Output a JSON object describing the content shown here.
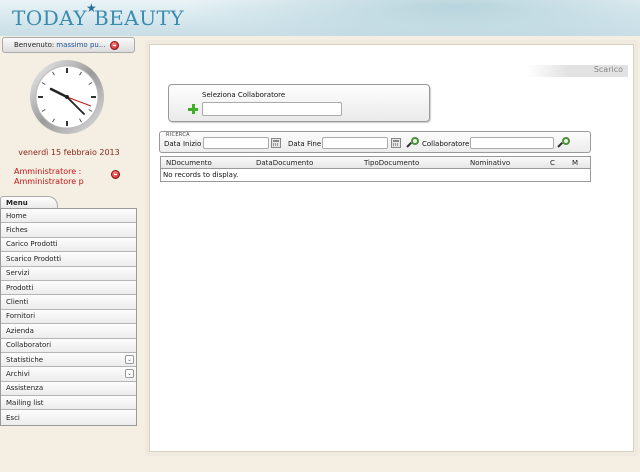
{
  "header": {
    "logo": "TODAY BEAUTY",
    "star": "★"
  },
  "welcome": {
    "label": "Benvenuto:",
    "user": "massimo pu..."
  },
  "date": "venerdì 15 febbraio 2013",
  "admin": {
    "line1": "Amministratore :",
    "line2": "Amministratore p"
  },
  "menu": {
    "tab": "Menu",
    "items": [
      {
        "label": "Home"
      },
      {
        "label": "Fiches"
      },
      {
        "label": "Carico Prodotti"
      },
      {
        "label": "Scarico Prodotti"
      },
      {
        "label": "Servizi"
      },
      {
        "label": "Prodotti"
      },
      {
        "label": "Clienti"
      },
      {
        "label": "Fornitori"
      },
      {
        "label": "Azienda"
      },
      {
        "label": "Collaboratori"
      },
      {
        "label": "Statistiche",
        "expandable": true
      },
      {
        "label": "Archivi",
        "expandable": true
      },
      {
        "label": "Assistenza"
      },
      {
        "label": "Mailing list"
      },
      {
        "label": "Esci"
      }
    ]
  },
  "main": {
    "title": "Scarico",
    "collab_label": "Seleziona Collaboratore",
    "collab_value": "",
    "search": {
      "legend": "RICERCA",
      "date_start_label": "Data Inizio",
      "date_end_label": "Data Fine",
      "collab_label": "Collaboratore",
      "date_start_value": "",
      "date_end_value": "",
      "collab_value": ""
    },
    "grid": {
      "columns": [
        "NDocumento",
        "DataDocumento",
        "TipoDocumento",
        "Nominativo",
        "C",
        "M"
      ],
      "empty": "No records to display."
    }
  }
}
